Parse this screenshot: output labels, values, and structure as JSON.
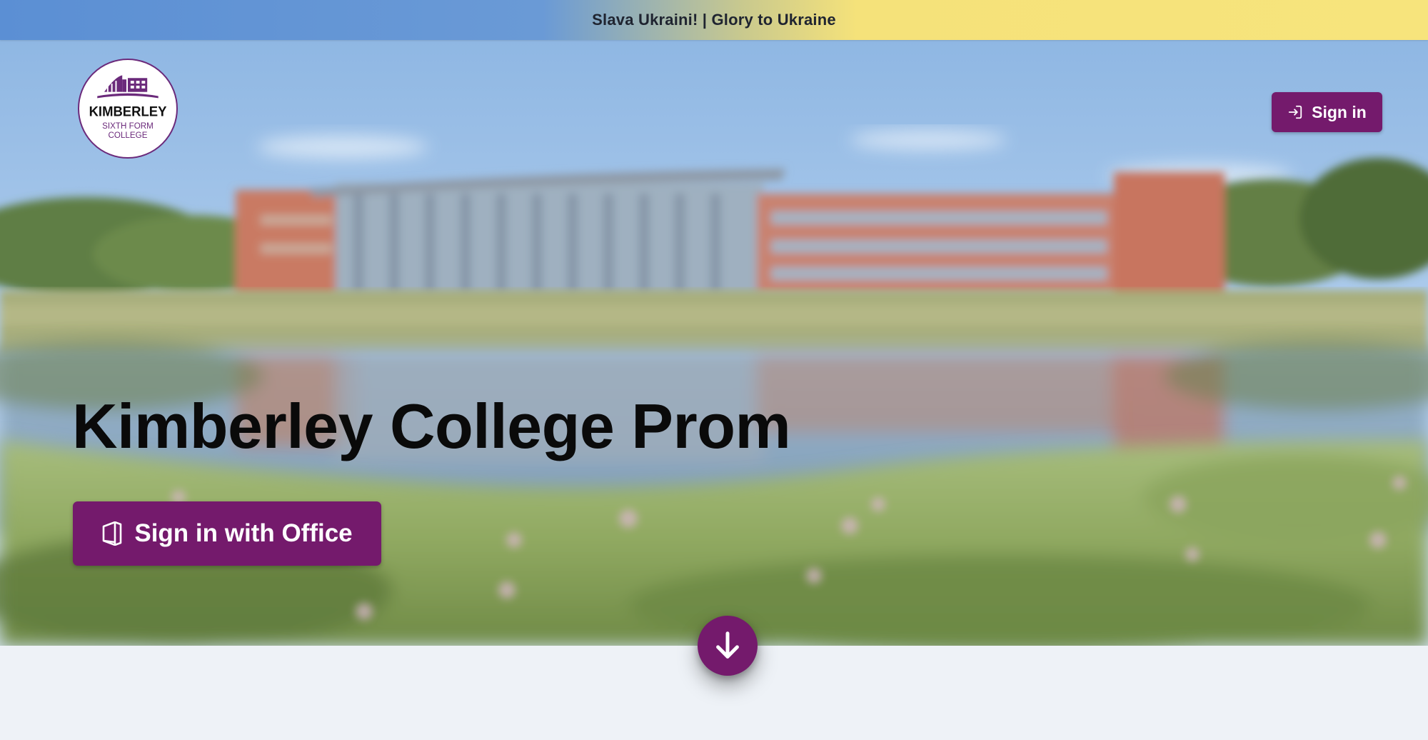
{
  "banner": {
    "text": "Slava Ukraini! | Glory to Ukraine"
  },
  "header": {
    "logo": {
      "name": "KIMBERLEY",
      "line2": "SIXTH FORM",
      "line3": "COLLEGE"
    },
    "sign_in_label": "Sign in",
    "sign_in_icon": "sign-in-arrow-icon"
  },
  "hero": {
    "title": "Kimberley College Prom",
    "office_button_label": "Sign in with Office",
    "office_icon": "office-icon",
    "scroll_icon": "arrow-down-icon"
  },
  "colors": {
    "brand_purple": "#741a6c",
    "banner_blue": "#5b8fd4",
    "banner_yellow": "#f7e47c",
    "page_background": "#eef2f7"
  }
}
